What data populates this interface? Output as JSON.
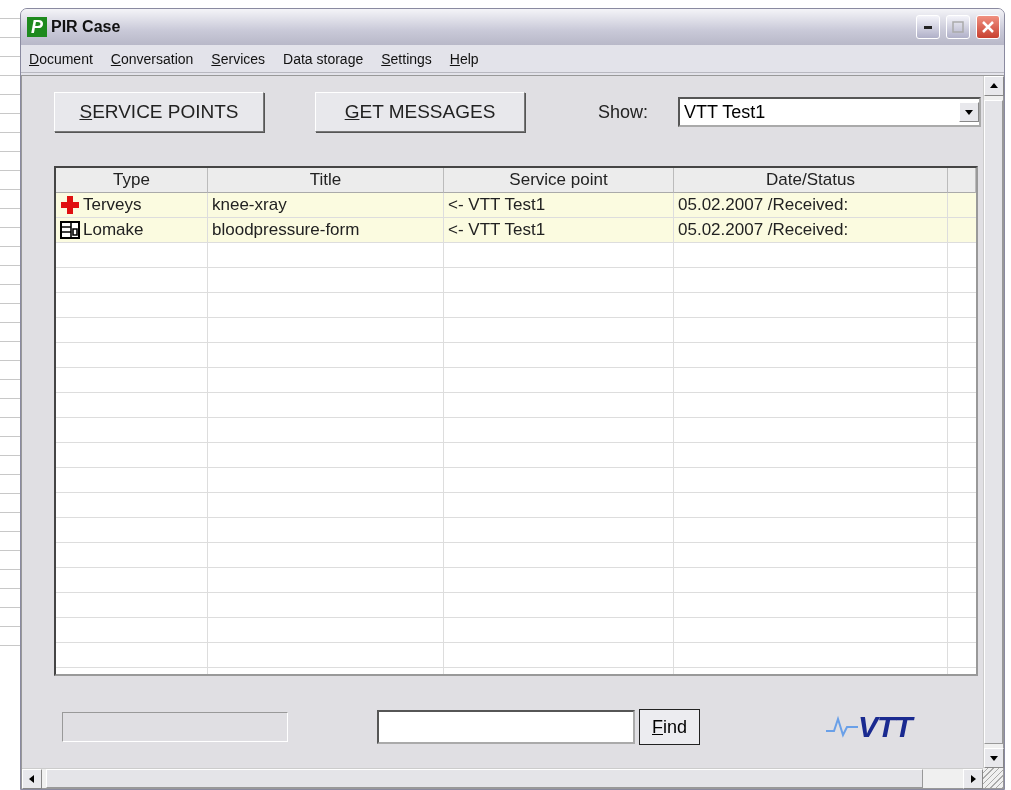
{
  "window": {
    "title": "PIR Case",
    "icon_letter": "P"
  },
  "menu": [
    {
      "key": "D",
      "post": "ocument"
    },
    {
      "key": "C",
      "post": "onversation"
    },
    {
      "key": "S",
      "post": "ervices"
    },
    {
      "label": "Data storage"
    },
    {
      "key": "S",
      "post": "ettings"
    },
    {
      "key": "H",
      "post": "elp"
    }
  ],
  "toolbar": {
    "buttons": [
      {
        "key": "S",
        "post": "ERVICE POINTS"
      },
      {
        "key": "G",
        "post": "ET MESSAGES"
      }
    ],
    "show_label": "Show:",
    "show_value": "VTT Test1"
  },
  "table": {
    "columns": [
      "Type",
      "Title",
      "Service point",
      "Date/Status"
    ],
    "rows": [
      {
        "kind": "health",
        "type": "Terveys",
        "title": "knee-xray",
        "service_point": "<- VTT Test1",
        "date_status": "05.02.2007 /Received:"
      },
      {
        "kind": "form",
        "type": "Lomake",
        "title": "bloodpressure-form",
        "service_point": "<- VTT Test1",
        "date_status": "05.02.2007 /Received:"
      }
    ]
  },
  "footer": {
    "find_button": {
      "key": "F",
      "post": "ind"
    },
    "logo_text": "VTT"
  }
}
